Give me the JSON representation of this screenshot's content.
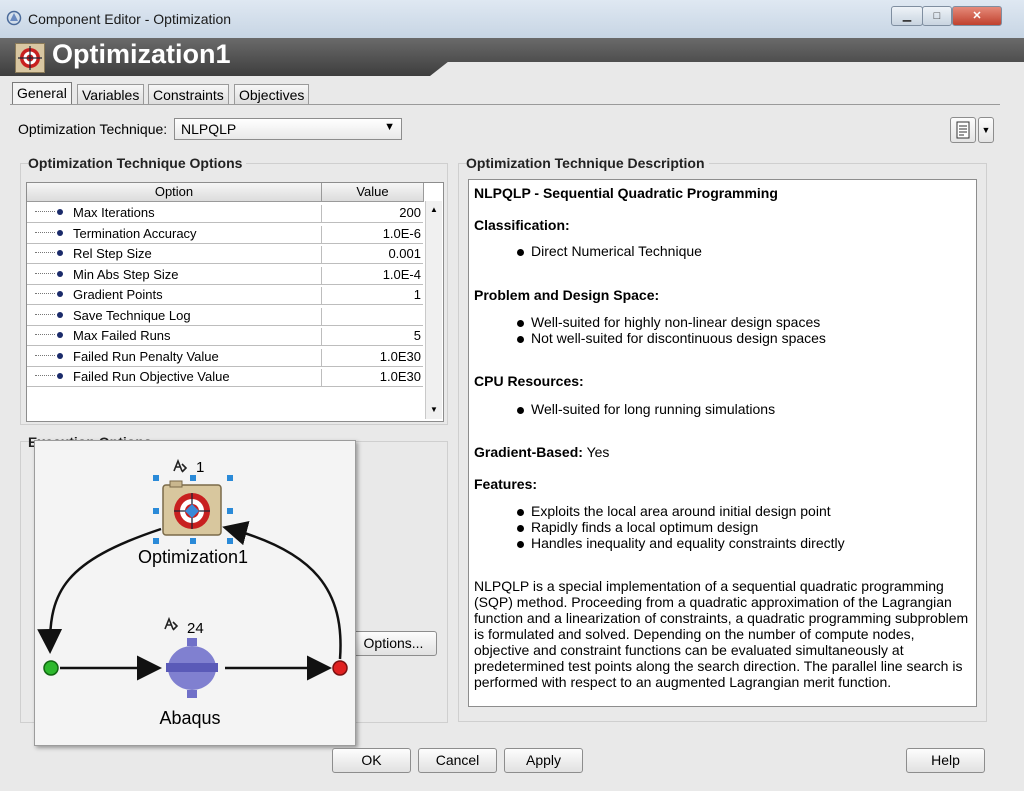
{
  "window": {
    "title": "Component Editor - Optimization",
    "controls": {
      "minimize": "▁",
      "maximize": "□",
      "close": "✕"
    }
  },
  "header": {
    "title": "Optimization1"
  },
  "tabs": [
    {
      "label": "General",
      "active": true
    },
    {
      "label": "Variables",
      "active": false
    },
    {
      "label": "Constraints",
      "active": false
    },
    {
      "label": "Objectives",
      "active": false
    }
  ],
  "technique": {
    "label": "Optimization Technique:",
    "value": "NLPQLP"
  },
  "options_panel": {
    "title": "Optimization Technique Options",
    "columns": [
      "Option",
      "Value"
    ],
    "rows": [
      {
        "name": "Max Iterations",
        "value": "200"
      },
      {
        "name": "Termination Accuracy",
        "value": "1.0E-6"
      },
      {
        "name": "Rel Step Size",
        "value": "0.001"
      },
      {
        "name": "Min Abs Step Size",
        "value": "1.0E-4"
      },
      {
        "name": "Gradient Points",
        "value": "1"
      },
      {
        "name": "Save Technique Log",
        "value": "",
        "checkbox": true,
        "checked": false
      },
      {
        "name": "Max Failed Runs",
        "value": "5"
      },
      {
        "name": "Failed Run Penalty Value",
        "value": "1.0E30"
      },
      {
        "name": "Failed Run Objective Value",
        "value": "1.0E30"
      }
    ]
  },
  "execution": {
    "title": "Execution Options",
    "options_button": "Options..."
  },
  "description": {
    "title": "Optimization Technique Description",
    "heading": "NLPQLP - Sequential Quadratic Programming",
    "classification": {
      "label": "Classification:",
      "items": [
        "Direct Numerical Technique"
      ]
    },
    "problem": {
      "label": "Problem and Design Space:",
      "items": [
        "Well-suited for highly non-linear design spaces",
        "Not well-suited for discontinuous design spaces"
      ]
    },
    "cpu": {
      "label": "CPU Resources:",
      "items": [
        "Well-suited for long running simulations"
      ]
    },
    "gradient": {
      "label": "Gradient-Based:",
      "value": "Yes"
    },
    "features": {
      "label": "Features:",
      "items": [
        "Exploits the local area around initial design point",
        "Rapidly finds a local optimum design",
        "Handles inequality and equality constraints directly"
      ]
    },
    "paragraph": "NLPQLP is a special implementation of a sequential quadratic programming (SQP) method. Proceeding from a quadratic approximation of the Lagrangian function and a linearization of constraints, a quadratic programming subproblem is formulated and solved. Depending on the number of compute nodes, objective and constraint functions can be evaluated simultaneously at predetermined test points along the search direction. The parallel line search is performed with respect to an augmented Lagrangian merit function."
  },
  "workflow": {
    "top_node": {
      "label": "Optimization1",
      "badge": "1"
    },
    "bottom_node": {
      "label": "Abaqus",
      "badge": "24"
    },
    "colors": {
      "start": "#2db82d",
      "end": "#e02020",
      "abaqus": "#7070c8"
    }
  },
  "footer": {
    "ok": "OK",
    "cancel": "Cancel",
    "apply": "Apply",
    "help": "Help"
  }
}
